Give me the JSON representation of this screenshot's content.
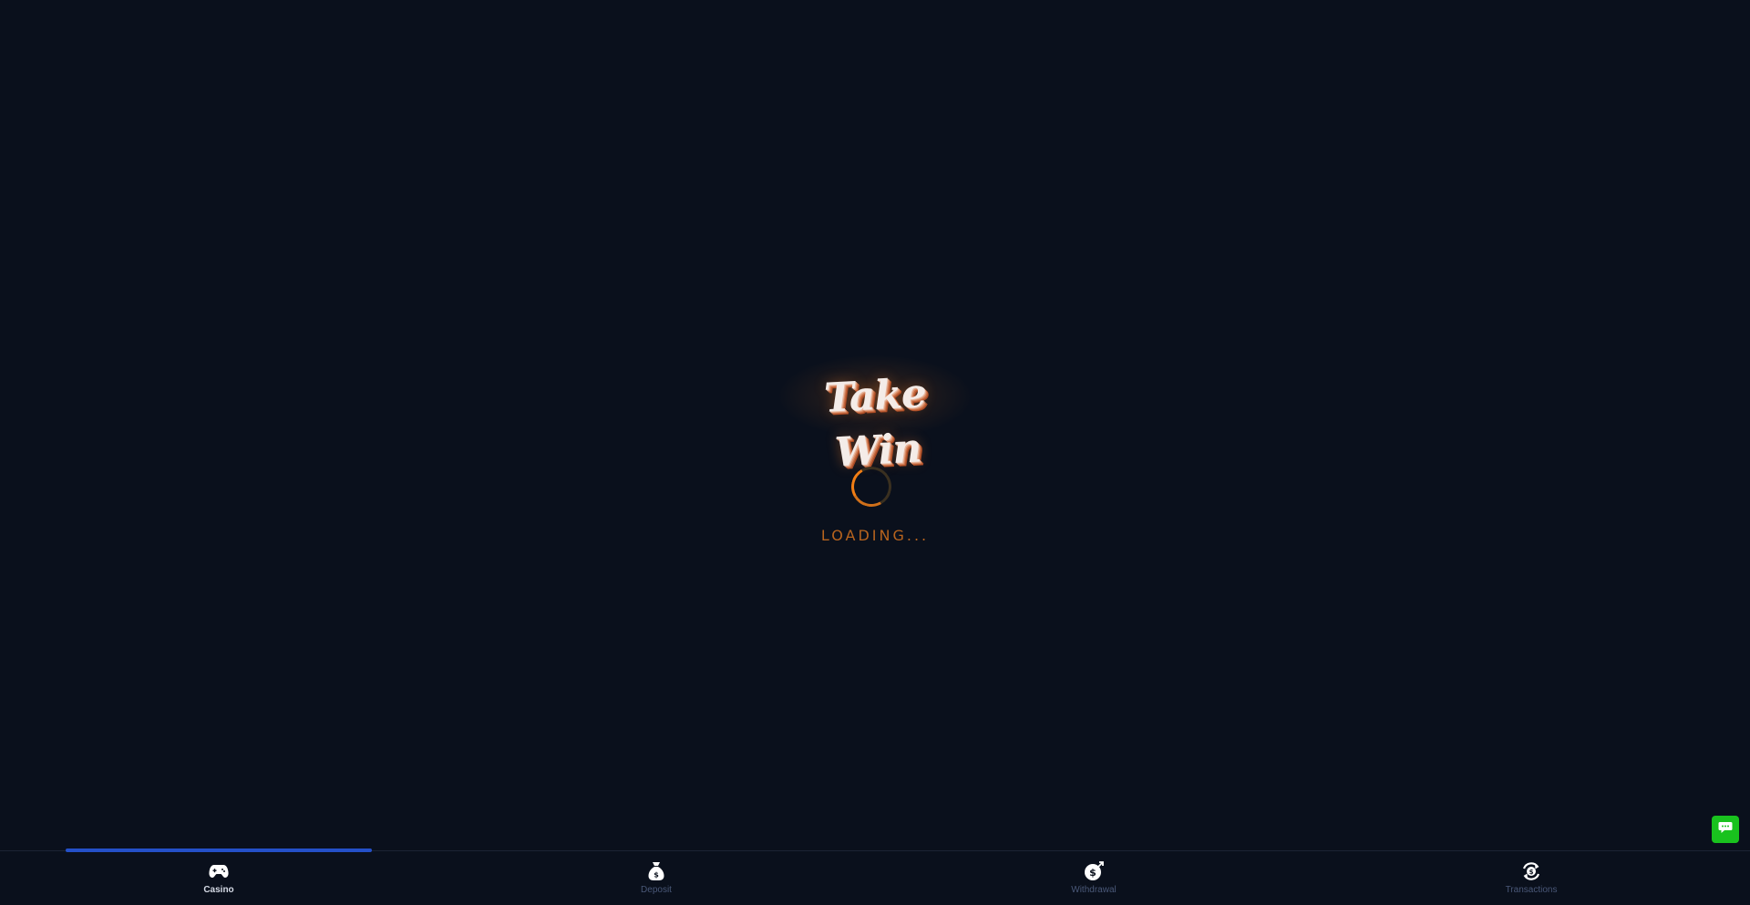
{
  "loader": {
    "logo_text": "Take Win",
    "loading_text": "LOADING..."
  },
  "bottom_nav": {
    "items": [
      {
        "label": "Casino",
        "icon": "gamepad-icon",
        "active": true
      },
      {
        "label": "Deposit",
        "icon": "money-bag-icon",
        "active": false
      },
      {
        "label": "Withdrawal",
        "icon": "dollar-coin-icon",
        "active": false
      },
      {
        "label": "Transactions",
        "icon": "coin-cycle-icon",
        "active": false
      }
    ]
  },
  "chat": {
    "icon": "chat-bubble-icon"
  },
  "colors": {
    "background": "#0a101c",
    "accent": "#f07d14",
    "nav_indicator": "#2450c8",
    "chat": "#19c21e"
  }
}
